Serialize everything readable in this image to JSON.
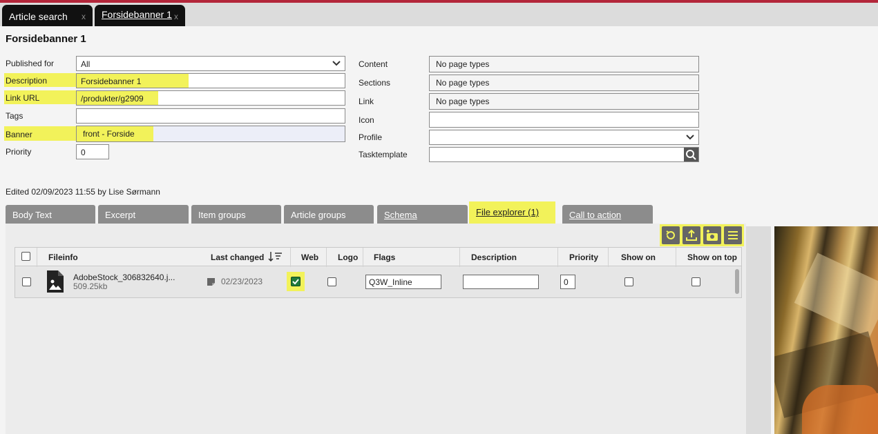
{
  "tabs": [
    {
      "label": "Article search",
      "close": "x"
    },
    {
      "label": "Forsidebanner 1",
      "close": "x"
    }
  ],
  "page_title": "Forsidebanner 1",
  "left_form": {
    "published_for": {
      "label": "Published for",
      "value": "All"
    },
    "description": {
      "label": "Description",
      "value": "Forsidebanner 1"
    },
    "link_url": {
      "label": "Link URL",
      "value": "/produkter/g2909"
    },
    "tags": {
      "label": "Tags",
      "value": ""
    },
    "banner": {
      "label": "Banner",
      "value": "front - Forside"
    },
    "priority": {
      "label": "Priority",
      "value": "0"
    }
  },
  "right_form": {
    "content": {
      "label": "Content",
      "value": "No page types"
    },
    "sections": {
      "label": "Sections",
      "value": "No page types"
    },
    "link": {
      "label": "Link",
      "value": "No page types"
    },
    "icon": {
      "label": "Icon",
      "value": ""
    },
    "profile": {
      "label": "Profile",
      "value": ""
    },
    "tasktemplate": {
      "label": "Tasktemplate",
      "value": ""
    }
  },
  "edited": "Edited 02/09/2023 11:55 by Lise Sørmann",
  "panel_tabs": [
    {
      "label": "Body Text"
    },
    {
      "label": "Excerpt"
    },
    {
      "label": "Item groups"
    },
    {
      "label": "Article groups"
    },
    {
      "label": "Schema"
    },
    {
      "label": "File explorer (1)"
    },
    {
      "label": "Call to action"
    }
  ],
  "toolbar": {
    "icons": [
      "refresh-icon",
      "upload-icon",
      "add-photo-icon",
      "menu-icon"
    ]
  },
  "file_table": {
    "headers": {
      "fileinfo": "Fileinfo",
      "last_changed": "Last changed",
      "web": "Web",
      "logo": "Logo",
      "flags": "Flags",
      "description": "Description",
      "priority": "Priority",
      "show_on": "Show on",
      "show_on_top": "Show on top"
    },
    "rows": [
      {
        "filename": "AdobeStock_306832640.j...",
        "size": "509.25kb",
        "date": "02/23/2023",
        "web": true,
        "logo": false,
        "flags": "Q3W_Inline",
        "description": "",
        "priority": "0",
        "show_on": false,
        "show_on_top": false
      }
    ]
  },
  "colors": {
    "accent_highlight": "#f2f25a",
    "top_line": "#b3263a",
    "tab_inactive": "#8c8c8c",
    "checkbox_checked": "#1f7a3a"
  }
}
